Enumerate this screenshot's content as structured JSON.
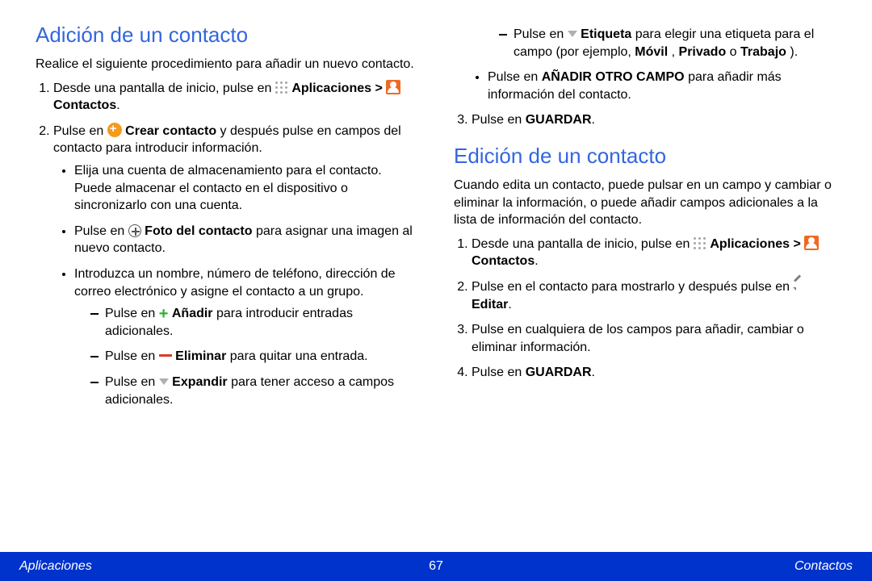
{
  "footer": {
    "left": "Aplicaciones",
    "page": "67",
    "right": "Contactos"
  },
  "left_col": {
    "heading": "Adición de un contacto",
    "intro": "Realice el siguiente procedimiento para añadir un nuevo contacto.",
    "step1_pre": "Desde una pantalla de inicio, pulse en ",
    "step1_apps": "Aplicaciones > ",
    "step1_contacts": " Contactos",
    "step1_suffix": ".",
    "step2_pre": "Pulse en ",
    "step2_create": " Crear contacto",
    "step2_post": " y después pulse en campos del contacto para introducir información.",
    "bul1": "Elija una cuenta de almacenamiento para el contacto. Puede almacenar el contacto en el dispositivo o sincronizarlo con una cuenta.",
    "bul2_pre": "Pulse en ",
    "bul2_bold": " Foto del contacto",
    "bul2_post": " para asignar una imagen al nuevo contacto.",
    "bul3": "Introduzca un nombre, número de teléfono, dirección de correo electrónico y asigne el contacto a un grupo.",
    "dash1_pre": "Pulse en ",
    "dash1_bold": " Añadir",
    "dash1_post": " para introducir entradas adicionales.",
    "dash2_pre": "Pulse en ",
    "dash2_bold": " Eliminar",
    "dash2_post": " para quitar una entrada.",
    "dash3_pre": "Pulse en ",
    "dash3_bold": " Expandir",
    "dash3_post": " para tener acceso a campos adicionales."
  },
  "right_col": {
    "cont_dash_pre": "Pulse en ",
    "cont_dash_bold": " Etiqueta",
    "cont_dash_mid": " para elegir una etiqueta para el campo (por ejemplo, ",
    "cont_dash_m": "Móvil",
    "cont_dash_c1": ", ",
    "cont_dash_p": "Privado",
    "cont_dash_c2": " o ",
    "cont_dash_t": "Trabajo",
    "cont_dash_end": ").",
    "cont_bul_pre": "Pulse en ",
    "cont_bul_bold": "AÑADIR OTRO CAMPO",
    "cont_bul_post": " para añadir más información del contacto.",
    "add_step3_pre": "Pulse en ",
    "add_step3_bold": "GUARDAR",
    "add_step3_post": ".",
    "heading2": "Edición de un contacto",
    "intro2": "Cuando edita un contacto, puede pulsar en un campo y cambiar o eliminar la información, o puede añadir campos adicionales a la lista de información del contacto.",
    "edit1_pre": "Desde una pantalla de inicio, pulse en ",
    "edit1_apps": "Aplicaciones > ",
    "edit1_contacts": " Contactos",
    "edit1_suffix": ".",
    "edit2_pre": "Pulse en el contacto para mostrarlo y después pulse en ",
    "edit2_bold": " Editar",
    "edit2_post": ".",
    "edit3": "Pulse en cualquiera de los campos para añadir, cambiar o eliminar información.",
    "edit4_pre": "Pulse en ",
    "edit4_bold": "GUARDAR",
    "edit4_post": "."
  }
}
